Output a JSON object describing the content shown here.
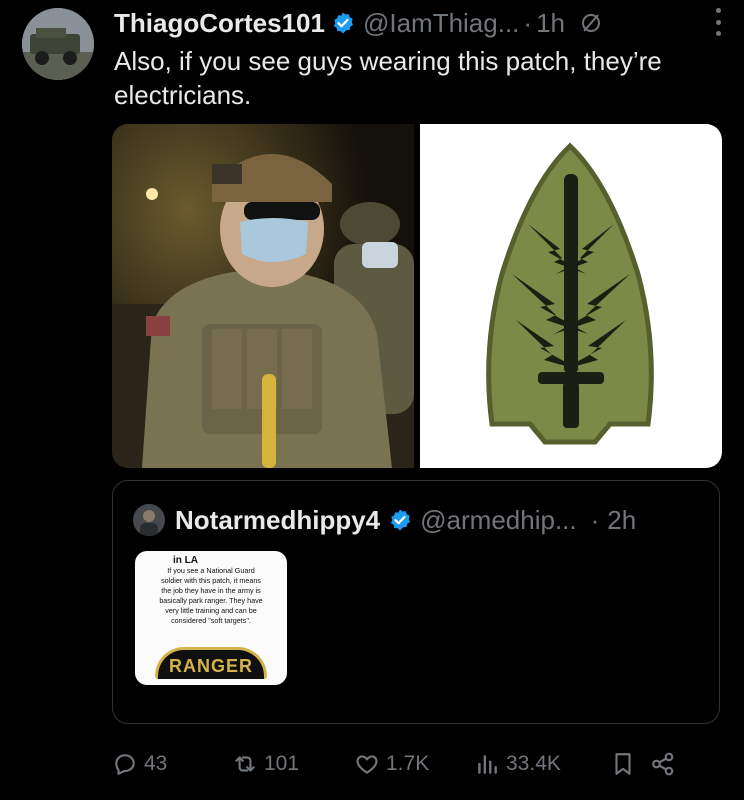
{
  "post": {
    "author_name": "ThiagoCortes101",
    "author_handle": "@IamThiag...",
    "separator": "·",
    "time": "1h",
    "text": "Also, if you see guys wearing this patch, they’re electricians.",
    "avatar_icon": "military-vehicle-avatar",
    "media": [
      {
        "icon": "soldier-photo"
      },
      {
        "icon": "special-forces-patch-image"
      }
    ]
  },
  "quote": {
    "author_name": "Notarmedhippy4",
    "author_handle": "@armedhip...",
    "separator": "·",
    "time": "2h",
    "thumb": {
      "title": "in LA",
      "lines": [
        "If you see a National Guard",
        "soldier with this patch, it means",
        "the job they have in the army is",
        "basically park ranger. They have",
        "very little training and can be",
        "considered \"soft targets\"."
      ],
      "patch_text": "RANGER"
    }
  },
  "actions": {
    "replies": "43",
    "reposts": "101",
    "likes": "1.7K",
    "views": "33.4K"
  },
  "colors": {
    "background": "#000000",
    "text_primary": "#e7e9ea",
    "text_secondary": "#71767b",
    "verified": "#1d9bf0",
    "border": "#2f3336"
  }
}
